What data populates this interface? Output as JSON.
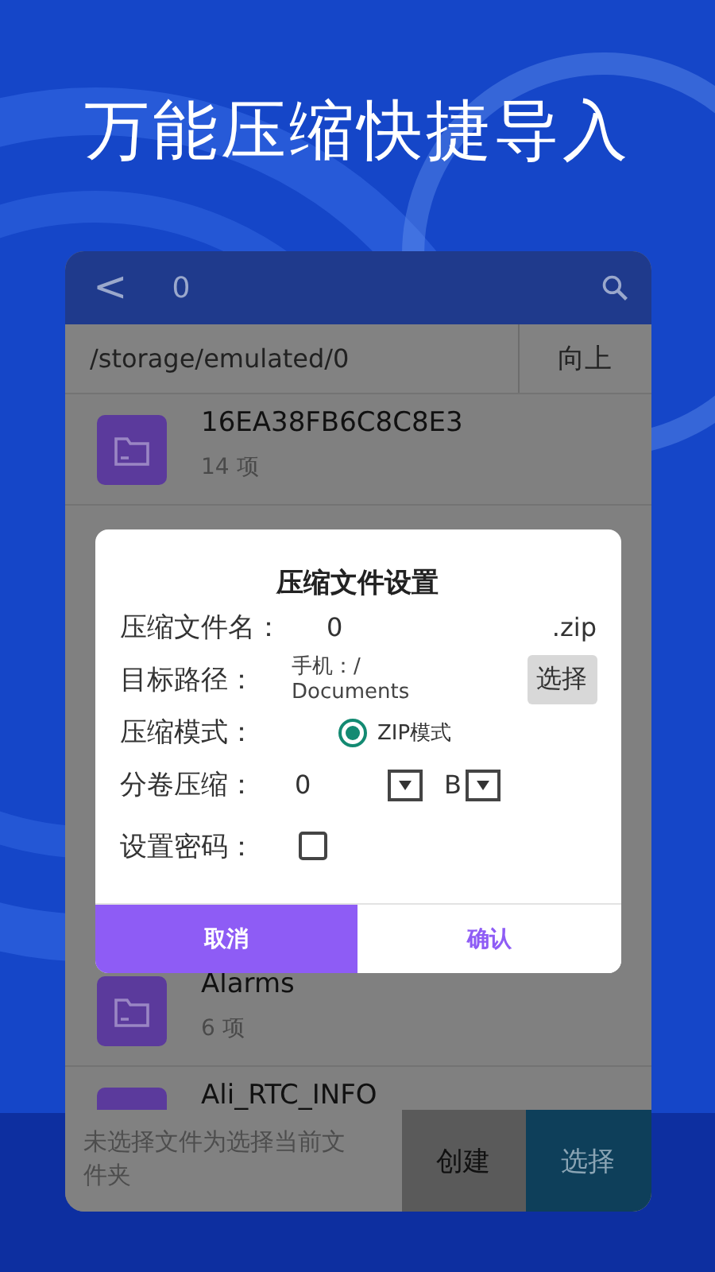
{
  "headline": "万能压缩快捷导入",
  "header": {
    "back": "<",
    "title": "0"
  },
  "path_bar": {
    "path": "/storage/emulated/0",
    "up_button": "向上"
  },
  "files": [
    {
      "name": "16EA38FB6C8C8E3",
      "count": "14 项"
    },
    {
      "name": "Alarms",
      "count": "6 项"
    },
    {
      "name": "Ali_RTC_INFO"
    }
  ],
  "dialog": {
    "title": "压缩文件设置",
    "file_name": {
      "label": "压缩文件名：",
      "value": "0",
      "suffix": ".zip"
    },
    "target": {
      "label": "目标路径：",
      "path": "手机：/ Documents",
      "button": "选择"
    },
    "mode": {
      "label": "压缩模式：",
      "option": "ZIP模式",
      "selected": true
    },
    "split": {
      "label": "分卷压缩：",
      "value": "0",
      "unit": "B"
    },
    "password": {
      "label": "设置密码：",
      "checked": false
    },
    "buttons": [
      {
        "label": "取消",
        "kind": "cancel"
      },
      {
        "label": "确认",
        "kind": "confirm"
      }
    ]
  },
  "bottom_bar": {
    "hint": "未选择文件为选择当前文件夹",
    "create": "创建",
    "select": "选择"
  }
}
